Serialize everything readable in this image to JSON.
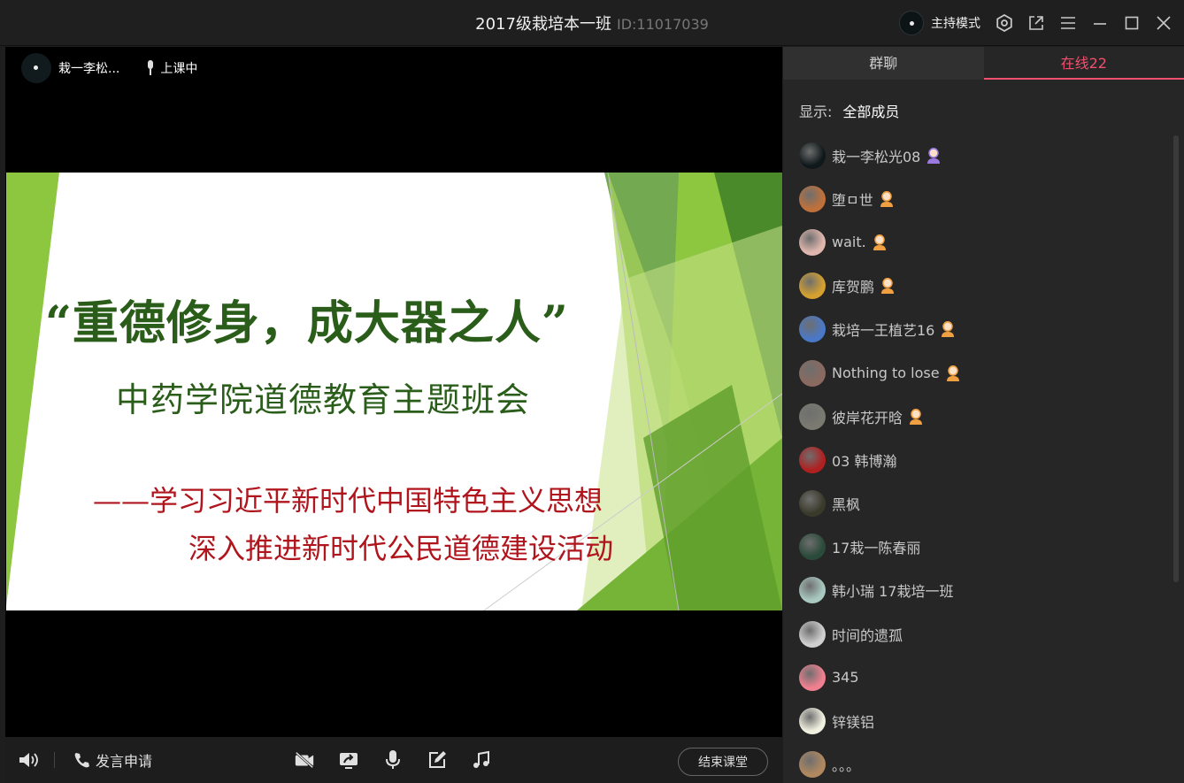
{
  "window": {
    "title": "2017级栽培本一班",
    "id_label": "ID:11017039",
    "host_mode": "主持模式"
  },
  "presenter": {
    "name": "栽一李松...",
    "status": "上课中"
  },
  "slide": {
    "title": "“重德修身，成大器之人”",
    "subtitle": "中药学院道德教育主题班会",
    "line1": "——学习习近平新时代中国特色主义思想",
    "line2": "深入推进新时代公民道德建设活动",
    "colors": {
      "title": "#2a5d1a",
      "accent": "#b0141c",
      "green_light": "#8dc63f",
      "green_dark": "#4a8a2a"
    }
  },
  "toolbar": {
    "apply_label": "发言申请",
    "end_label": "结束课堂",
    "tools": [
      "camera-off-icon",
      "screen-share-icon",
      "microphone-icon",
      "edit-icon",
      "music-icon"
    ]
  },
  "sidebar": {
    "tabs": {
      "chat": "群聊",
      "online": "在线22"
    },
    "filter_label": "显示:",
    "filter_value": "全部成员",
    "accent": "#f0506e",
    "members": [
      {
        "name": "栽一李松光08",
        "role": "teacher",
        "avatar_color": "#0f181a"
      },
      {
        "name": "堕ㅁ世",
        "role": "student",
        "avatar_color": "#c0703a"
      },
      {
        "name": "wait.",
        "role": "student",
        "avatar_color": "#e0b7ae"
      },
      {
        "name": "库贺鹏",
        "role": "student",
        "avatar_color": "#d4a030"
      },
      {
        "name": "栽培一王植艺16",
        "role": "student",
        "avatar_color": "#4a78c8"
      },
      {
        "name": "Nothing to lose",
        "role": "student",
        "avatar_color": "#8a6a60"
      },
      {
        "name": "彼岸花开晗",
        "role": "student",
        "avatar_color": "#7a7a70"
      },
      {
        "name": "03 韩博瀚",
        "role": "none",
        "avatar_color": "#b02020"
      },
      {
        "name": "黑枫",
        "role": "none",
        "avatar_color": "#3a3a2a"
      },
      {
        "name": "17栽一陈春丽",
        "role": "none",
        "avatar_color": "#2a4a3a"
      },
      {
        "name": "韩小瑞 17栽培一班",
        "role": "none",
        "avatar_color": "#a8c8c0"
      },
      {
        "name": "时间的遗孤",
        "role": "none",
        "avatar_color": "#d0d0d0"
      },
      {
        "name": "345",
        "role": "none",
        "avatar_color": "#f08090"
      },
      {
        "name": "锌镁铝",
        "role": "none",
        "avatar_color": "#f0f0e0"
      },
      {
        "name": "。。。",
        "role": "none",
        "avatar_color": "#b08860"
      }
    ]
  }
}
